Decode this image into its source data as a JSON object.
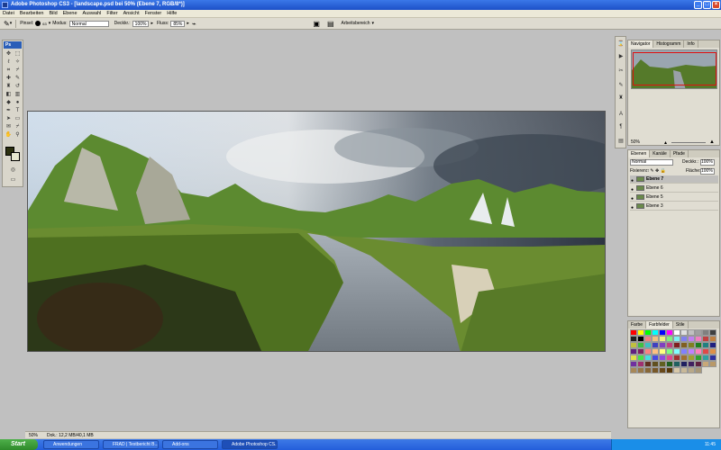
{
  "window": {
    "title": "Adobe Photoshop CS3 - [landscape.psd bei 50% (Ebene 7, RGB/8*)]"
  },
  "menu": [
    "Datei",
    "Bearbeiten",
    "Bild",
    "Ebene",
    "Auswahl",
    "Filter",
    "Ansicht",
    "Fenster",
    "Hilfe"
  ],
  "options": {
    "brush_label": "Pinsel:",
    "brush_size": "63",
    "mode_label": "Modus:",
    "mode_value": "Normal",
    "opacity_label": "Deckkr.:",
    "opacity_value": "100%",
    "flow_label": "Fluss:",
    "flow_value": "85%",
    "workspace": "Arbeitsbereich"
  },
  "tools": {
    "badge": "Ps"
  },
  "navigator": {
    "tabs": [
      "Navigator",
      "Histogramm",
      "Info"
    ],
    "zoom": "50%"
  },
  "layers": {
    "tabs": [
      "Ebenen",
      "Kanäle",
      "Pfade"
    ],
    "blend": "Normal",
    "opacity_label": "Deckkr.:",
    "opacity": "100%",
    "lock_label": "Fixieren:",
    "fill_label": "Fläche:",
    "fill": "100%",
    "items": [
      {
        "name": "Ebene 7",
        "selected": true
      },
      {
        "name": "Ebene 6",
        "selected": false
      },
      {
        "name": "Ebene 5",
        "selected": false
      },
      {
        "name": "Ebene 3",
        "selected": false
      }
    ]
  },
  "swatches": {
    "tabs": [
      "Farbe",
      "Farbfelder",
      "Stile"
    ],
    "colors": [
      "#ff0000",
      "#ffff00",
      "#00ff00",
      "#00ffff",
      "#0000ff",
      "#ff00ff",
      "#ffffff",
      "#e0e0e0",
      "#c0c0c0",
      "#a0a0a0",
      "#808080",
      "#404040",
      "#202020",
      "#000000",
      "#f08080",
      "#f0c080",
      "#f0f080",
      "#80f080",
      "#80f0f0",
      "#8080f0",
      "#c080f0",
      "#f080c0",
      "#c04040",
      "#c08040",
      "#c0c040",
      "#40c040",
      "#40c0c0",
      "#4040c0",
      "#8040c0",
      "#c04080",
      "#802020",
      "#806020",
      "#808020",
      "#208020",
      "#208080",
      "#202080",
      "#602080",
      "#802060",
      "#ff8080",
      "#ffc080",
      "#ffff80",
      "#80ff80",
      "#80ffff",
      "#8080ff",
      "#c080ff",
      "#ff80c0",
      "#e04848",
      "#e09048",
      "#e0e048",
      "#48e048",
      "#48e0e0",
      "#4848e0",
      "#9048e0",
      "#e04890",
      "#a03030",
      "#a07030",
      "#a0a030",
      "#30a030",
      "#30a0a0",
      "#3030a0",
      "#7030a0",
      "#a03070",
      "#603020",
      "#605020",
      "#606020",
      "#206020",
      "#206060",
      "#202060",
      "#402060",
      "#602040",
      "#c8a878",
      "#b89868",
      "#a88858",
      "#987848",
      "#886838",
      "#785828",
      "#684818",
      "#583808",
      "#d8c8a8",
      "#c8b898",
      "#b8a888",
      "#a89878"
    ]
  },
  "status": {
    "zoom": "50%",
    "doc": "Dok.: 12,2 MB/40,1 MB"
  },
  "taskbar": {
    "start": "Start",
    "tasks": [
      "Anwendungen",
      "FRAD | Testbericht B...",
      "Add-ons",
      "Adobe Photoshop CS..."
    ],
    "clock": "11:45"
  }
}
